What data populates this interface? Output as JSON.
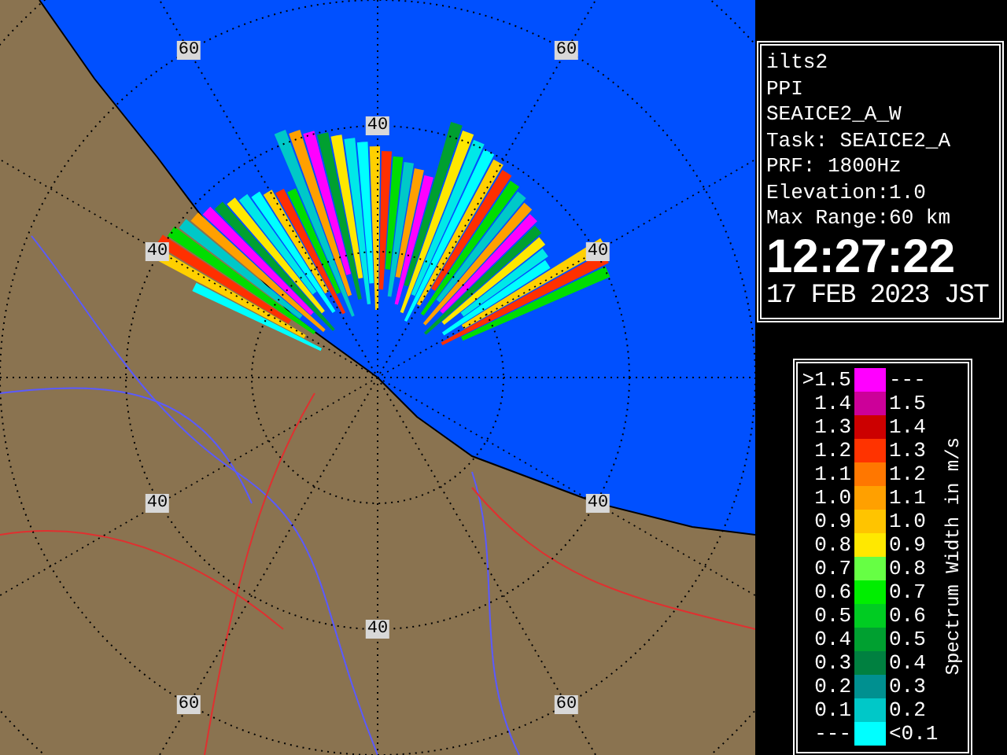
{
  "radar_map": {
    "range_labels": [
      "60",
      "60",
      "40",
      "40",
      "40",
      "40",
      "40",
      "40",
      "60",
      "60"
    ]
  },
  "info": {
    "lines": [
      "ilts2",
      "PPI",
      "SEAICE2_A_W",
      "Task: SEAICE2_A",
      "PRF: 1800Hz",
      "Elevation:1.0",
      "Max Range:60 km"
    ],
    "time": "12:27:22",
    "date": "17 FEB 2023 JST"
  },
  "legend": {
    "title": "Spectrum Width in m/s",
    "rows": [
      {
        "low": ">1.5",
        "high": "---",
        "color": "#ff00ff"
      },
      {
        "low": "1.4",
        "high": "1.5",
        "color": "#cc0099"
      },
      {
        "low": "1.3",
        "high": "1.4",
        "color": "#cc0000"
      },
      {
        "low": "1.2",
        "high": "1.3",
        "color": "#ff3300"
      },
      {
        "low": "1.1",
        "high": "1.2",
        "color": "#ff7700"
      },
      {
        "low": "1.0",
        "high": "1.1",
        "color": "#ffa000"
      },
      {
        "low": "0.9",
        "high": "1.0",
        "color": "#ffc400"
      },
      {
        "low": "0.8",
        "high": "0.9",
        "color": "#ffe800"
      },
      {
        "low": "0.7",
        "high": "0.8",
        "color": "#66ff44"
      },
      {
        "low": "0.6",
        "high": "0.7",
        "color": "#00ee00"
      },
      {
        "low": "0.5",
        "high": "0.6",
        "color": "#00cc22"
      },
      {
        "low": "0.4",
        "high": "0.5",
        "color": "#00a030"
      },
      {
        "low": "0.3",
        "high": "0.4",
        "color": "#008040"
      },
      {
        "low": "0.2",
        "high": "0.3",
        "color": "#009090"
      },
      {
        "low": "0.1",
        "high": "0.2",
        "color": "#00c8c8"
      },
      {
        "low": "---",
        "high": "<0.1",
        "color": "#00ffff"
      }
    ]
  }
}
